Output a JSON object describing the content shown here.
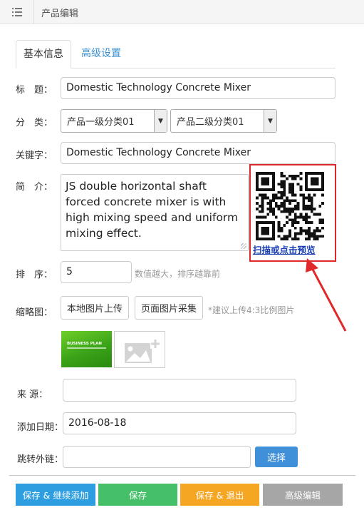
{
  "header": {
    "title": "产品编辑",
    "menu_icon": "list-icon"
  },
  "tabs": [
    {
      "label": "基本信息",
      "active": true
    },
    {
      "label": "高级设置",
      "active": false
    }
  ],
  "form": {
    "title": {
      "label": "标　题：",
      "value": "Domestic Technology Concrete Mixer"
    },
    "category": {
      "label": "分　类：",
      "primary": "产品一级分类01",
      "secondary": "产品二级分类01"
    },
    "keywords": {
      "label": "关键字：",
      "value": "Domestic Technology Concrete Mixer"
    },
    "summary": {
      "label": "简　介：",
      "value": "JS double horizontal shaft forced concrete mixer is with high mixing speed and uniform mixing effect."
    },
    "qr": {
      "link_text": "扫描或点击预览"
    },
    "order": {
      "label": "排　序：",
      "value": "5",
      "hint": "数值越大，排序越靠前"
    },
    "thumbnail": {
      "label": "缩略图：",
      "upload_local": "本地图片上传",
      "collect_page": "页面图片采集",
      "hint": "*建议上传4:3比例图片",
      "image_text": "BUSINESS PLAN"
    },
    "source": {
      "label": "来 源：",
      "value": ""
    },
    "date": {
      "label": "添加日期：",
      "value": "2016-08-18"
    },
    "redirect": {
      "label": "跳转外链：",
      "value": "",
      "choose": "选择"
    }
  },
  "footer": {
    "buttons": [
      {
        "label": "保存 & 继续添加",
        "color": "#2e9ee0"
      },
      {
        "label": "保存",
        "color": "#45c068"
      },
      {
        "label": "保存 & 退出",
        "color": "#f5a623"
      },
      {
        "label": "高级编辑",
        "color": "#a6a6a6"
      }
    ]
  },
  "colors": {
    "accent": "#3f90d8",
    "highlight": "#e0292a",
    "link": "#1a3fb5"
  }
}
